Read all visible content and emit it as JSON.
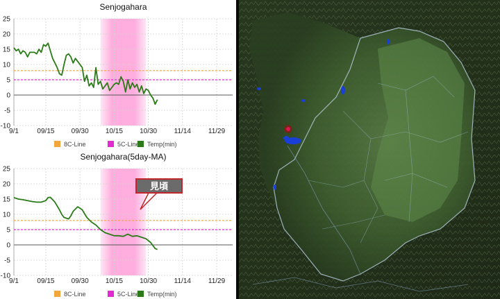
{
  "colors": {
    "line8": "#f2a63d",
    "line5": "#e02bd0",
    "temp": "#2a7a17",
    "band": "#ff9fd8",
    "callout_fill": "#6b6b6b",
    "callout_border": "#c0262b"
  },
  "chart_data": [
    {
      "type": "line",
      "title": "Senjogahara",
      "x_tick_labels": [
        "9/1",
        "09/15",
        "09/30",
        "10/15",
        "10/30",
        "11/14",
        "11/29"
      ],
      "x_tick_days": [
        0,
        14,
        29,
        44,
        59,
        74,
        89
      ],
      "xlim": [
        0,
        96
      ],
      "ylim": [
        -10,
        25
      ],
      "y_ticks": [
        -10,
        -5,
        0,
        5,
        10,
        15,
        20,
        25
      ],
      "grid": true,
      "legend_position": "bottom",
      "highlight_band_days": [
        38,
        58
      ],
      "series": [
        {
          "name": "8C-Line",
          "style": "dashed",
          "x": [
            0,
            96
          ],
          "values": [
            8,
            8
          ]
        },
        {
          "name": "5C-Line",
          "style": "dashed",
          "x": [
            0,
            96
          ],
          "values": [
            5,
            5
          ]
        },
        {
          "name": "Temp(min)",
          "style": "solid",
          "x": [
            0,
            1,
            2,
            3,
            4,
            5,
            6,
            7,
            8,
            9,
            10,
            11,
            12,
            13,
            14,
            15,
            16,
            17,
            18,
            19,
            20,
            21,
            22,
            23,
            24,
            25,
            26,
            27,
            28,
            29,
            30,
            31,
            32,
            33,
            34,
            35,
            36,
            37,
            38,
            39,
            40,
            41,
            42,
            43,
            44,
            45,
            46,
            47,
            48,
            49,
            50,
            51,
            52,
            53,
            54,
            55,
            56,
            57,
            58,
            59,
            60,
            61,
            62,
            63
          ],
          "values": [
            15.5,
            14.5,
            15,
            13.5,
            14.5,
            14,
            12.5,
            14,
            14,
            14,
            13.5,
            15,
            14,
            16.5,
            16,
            17,
            14.5,
            12,
            10.5,
            9,
            7,
            6.5,
            10,
            13,
            13.5,
            12.5,
            10.5,
            12,
            11,
            10,
            9,
            4.5,
            6.5,
            3,
            4,
            2.5,
            9,
            3.5,
            4.5,
            2,
            3,
            4,
            1.5,
            2.5,
            3.5,
            4,
            3.5,
            6,
            4.5,
            1,
            5,
            2,
            4,
            2.5,
            3.5,
            1,
            3,
            0.5,
            2,
            1.5,
            0,
            -1,
            -3,
            -1.5
          ]
        }
      ]
    },
    {
      "type": "line",
      "title": "Senjogahara(5day-MA)",
      "x_tick_labels": [
        "9/1",
        "09/15",
        "09/30",
        "10/15",
        "10/30",
        "11/14",
        "11/29"
      ],
      "x_tick_days": [
        0,
        14,
        29,
        44,
        59,
        74,
        89
      ],
      "xlim": [
        0,
        96
      ],
      "ylim": [
        -10,
        25
      ],
      "y_ticks": [
        -10,
        -5,
        0,
        5,
        10,
        15,
        20,
        25
      ],
      "grid": true,
      "legend_position": "bottom",
      "highlight_band_days": [
        38,
        58
      ],
      "annotation": {
        "text": "見頃"
      },
      "series": [
        {
          "name": "8C-Line",
          "style": "dashed",
          "x": [
            0,
            96
          ],
          "values": [
            8,
            8
          ]
        },
        {
          "name": "5C-Line",
          "style": "dashed",
          "x": [
            0,
            96
          ],
          "values": [
            5,
            5
          ]
        },
        {
          "name": "Temp(min)",
          "style": "solid",
          "x": [
            0,
            2,
            4,
            6,
            8,
            10,
            12,
            14,
            15,
            16,
            18,
            20,
            21,
            22,
            24,
            25,
            26,
            28,
            30,
            32,
            34,
            36,
            38,
            40,
            42,
            44,
            46,
            48,
            50,
            52,
            54,
            56,
            58,
            60,
            62,
            63
          ],
          "values": [
            15.5,
            15,
            14.8,
            14.5,
            14.2,
            14,
            14,
            14.5,
            15.5,
            15.6,
            14,
            11.5,
            10,
            9,
            8.5,
            9.5,
            11,
            12.5,
            11.5,
            9,
            7.5,
            6.5,
            5,
            4,
            3.5,
            3,
            3,
            2.8,
            3.5,
            2.8,
            3,
            2.5,
            2,
            0.8,
            -1.2,
            -1.5
          ]
        }
      ]
    }
  ],
  "map": {
    "marker_color": "#e2144f"
  }
}
